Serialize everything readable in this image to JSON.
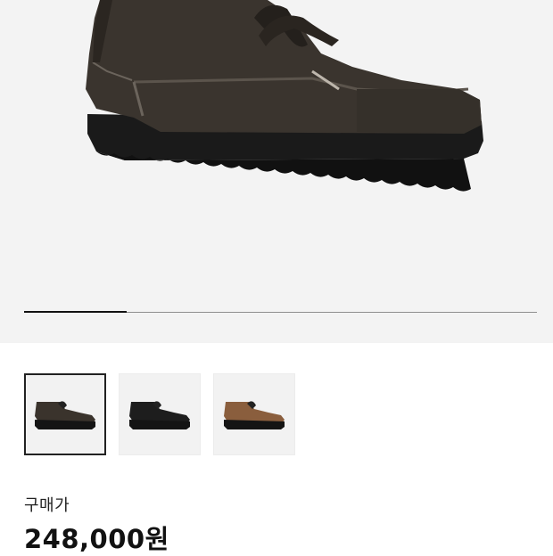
{
  "product": {
    "image_name": "shoe-main-image",
    "gallery_position": 0.2,
    "thumbnails": [
      {
        "name": "thumb-dark-brown-suede",
        "color": "#3a332c",
        "selected": true
      },
      {
        "name": "thumb-black-leather",
        "color": "#1d1d1d",
        "selected": false
      },
      {
        "name": "thumb-tan-suede",
        "color": "#8a5e3d",
        "selected": false
      }
    ],
    "price_label": "구매가",
    "price": "248,000원"
  }
}
